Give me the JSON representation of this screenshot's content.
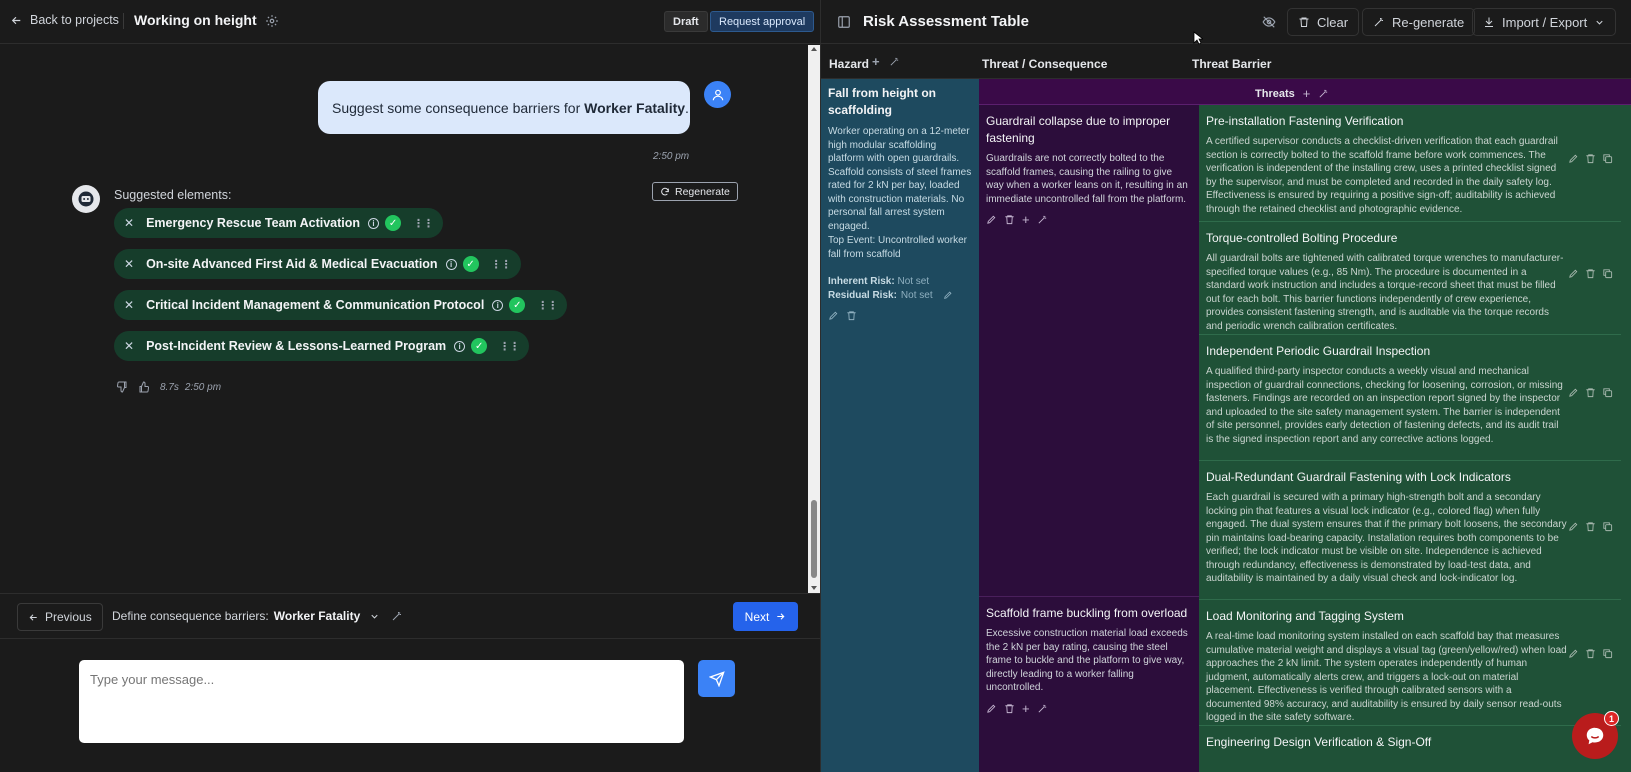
{
  "header": {
    "back_label": "Back to projects",
    "project_title": "Working on height",
    "draft_badge": "Draft",
    "request_approval": "Request approval"
  },
  "chat": {
    "user_message_prefix": "Suggest some consequence barriers for ",
    "user_message_bold": "Worker Fatality",
    "user_message_suffix": ".",
    "user_time": "2:50 pm",
    "suggested_label": "Suggested elements:",
    "regenerate_label": "Regenerate",
    "chips": [
      {
        "label": "Emergency Rescue Team Activation"
      },
      {
        "label": "On-site Advanced First Aid & Medical Evacuation"
      },
      {
        "label": "Critical Incident Management & Communication Protocol"
      },
      {
        "label": "Post-Incident Review & Lessons-Learned Program"
      }
    ],
    "duration": "8.7s",
    "bot_time": "2:50 pm"
  },
  "nav": {
    "previous": "Previous",
    "step_label": "Define consequence barriers:",
    "step_value": "Worker Fatality",
    "next": "Next"
  },
  "composer": {
    "placeholder": "Type your message..."
  },
  "table": {
    "title": "Risk Assessment Table",
    "clear": "Clear",
    "regenerate": "Re-generate",
    "import_export": "Import / Export",
    "col_hazard": "Hazard",
    "col_threat": "Threat / Consequence",
    "col_barrier": "Threat Barrier",
    "threats_label": "Threats",
    "hazard": {
      "title": "Fall from height on scaffolding",
      "description": "Worker operating on a 12-meter high modular scaffolding platform with open guardrails. Scaffold consists of steel frames rated for 2 kN per bay, loaded with construction materials. No personal fall arrest system engaged.",
      "top_event": "Top Event: Uncontrolled worker fall from scaffold",
      "inherent_label": "Inherent Risk:",
      "inherent_value": "Not set",
      "residual_label": "Residual Risk:",
      "residual_value": "Not set"
    },
    "threats": [
      {
        "title": "Guardrail collapse due to improper fastening",
        "description": "Guardrails are not correctly bolted to the scaffold frames, causing the railing to give way when a worker leans on it, resulting in an immediate uncontrolled fall from the platform."
      },
      {
        "title": "Scaffold frame buckling from overload",
        "description": "Excessive construction material load exceeds the 2 kN per bay rating, causing the steel frame to buckle and the platform to give way, directly leading to a worker falling uncontrolled."
      }
    ],
    "barriers": [
      {
        "title": "Pre-installation Fastening Verification",
        "description": "A certified supervisor conducts a checklist-driven verification that each guardrail section is correctly bolted to the scaffold frame before work commences. The verification is independent of the installing crew, uses a printed checklist signed by the supervisor, and must be completed and recorded in the daily safety log. Effectiveness is ensured by requiring a positive sign-off; auditability is achieved through the retained checklist and photographic evidence."
      },
      {
        "title": "Torque-controlled Bolting Procedure",
        "description": "All guardrail bolts are tightened with calibrated torque wrenches to manufacturer-specified torque values (e.g., 85 Nm). The procedure is documented in a standard work instruction and includes a torque-record sheet that must be filled out for each bolt. This barrier functions independently of crew experience, provides consistent fastening strength, and is auditable via the torque records and periodic wrench calibration certificates."
      },
      {
        "title": "Independent Periodic Guardrail Inspection",
        "description": "A qualified third-party inspector conducts a weekly visual and mechanical inspection of guardrail connections, checking for loosening, corrosion, or missing fasteners. Findings are recorded on an inspection report signed by the inspector and uploaded to the site safety management system. The barrier is independent of site personnel, provides early detection of fastening defects, and its audit trail is the signed inspection report and any corrective actions logged."
      },
      {
        "title": "Dual-Redundant Guardrail Fastening with Lock Indicators",
        "description": "Each guardrail is secured with a primary high-strength bolt and a secondary locking pin that features a visual lock indicator (e.g., colored flag) when fully engaged. The dual system ensures that if the primary bolt loosens, the secondary pin maintains load-bearing capacity. Installation requires both components to be verified; the lock indicator must be visible on site. Independence is achieved through redundancy, effectiveness is demonstrated by load-test data, and auditability is maintained by a daily visual check and lock-indicator log."
      },
      {
        "title": "Load Monitoring and Tagging System",
        "description": "A real-time load monitoring system installed on each scaffold bay that measures cumulative material weight and displays a visual tag (green/yellow/red) when load approaches the 2 kN limit. The system operates independently of human judgment, automatically alerts crew, and triggers a lock-out on material placement. Effectiveness is verified through calibrated sensors with a documented 98% accuracy, and auditability is ensured by daily sensor read-outs logged in the site safety software."
      },
      {
        "title": "Engineering Design Verification & Sign-Off",
        "description": ""
      }
    ],
    "notification_count": "1"
  },
  "colors": {
    "accent": "#2563eb",
    "hazard_bg": "#1e4a5f",
    "threat_bg": "#2c0d3b",
    "barrier_bg": "#1f5137",
    "chip_bg": "#163d2b",
    "chat_widget": "#b91c1c"
  }
}
